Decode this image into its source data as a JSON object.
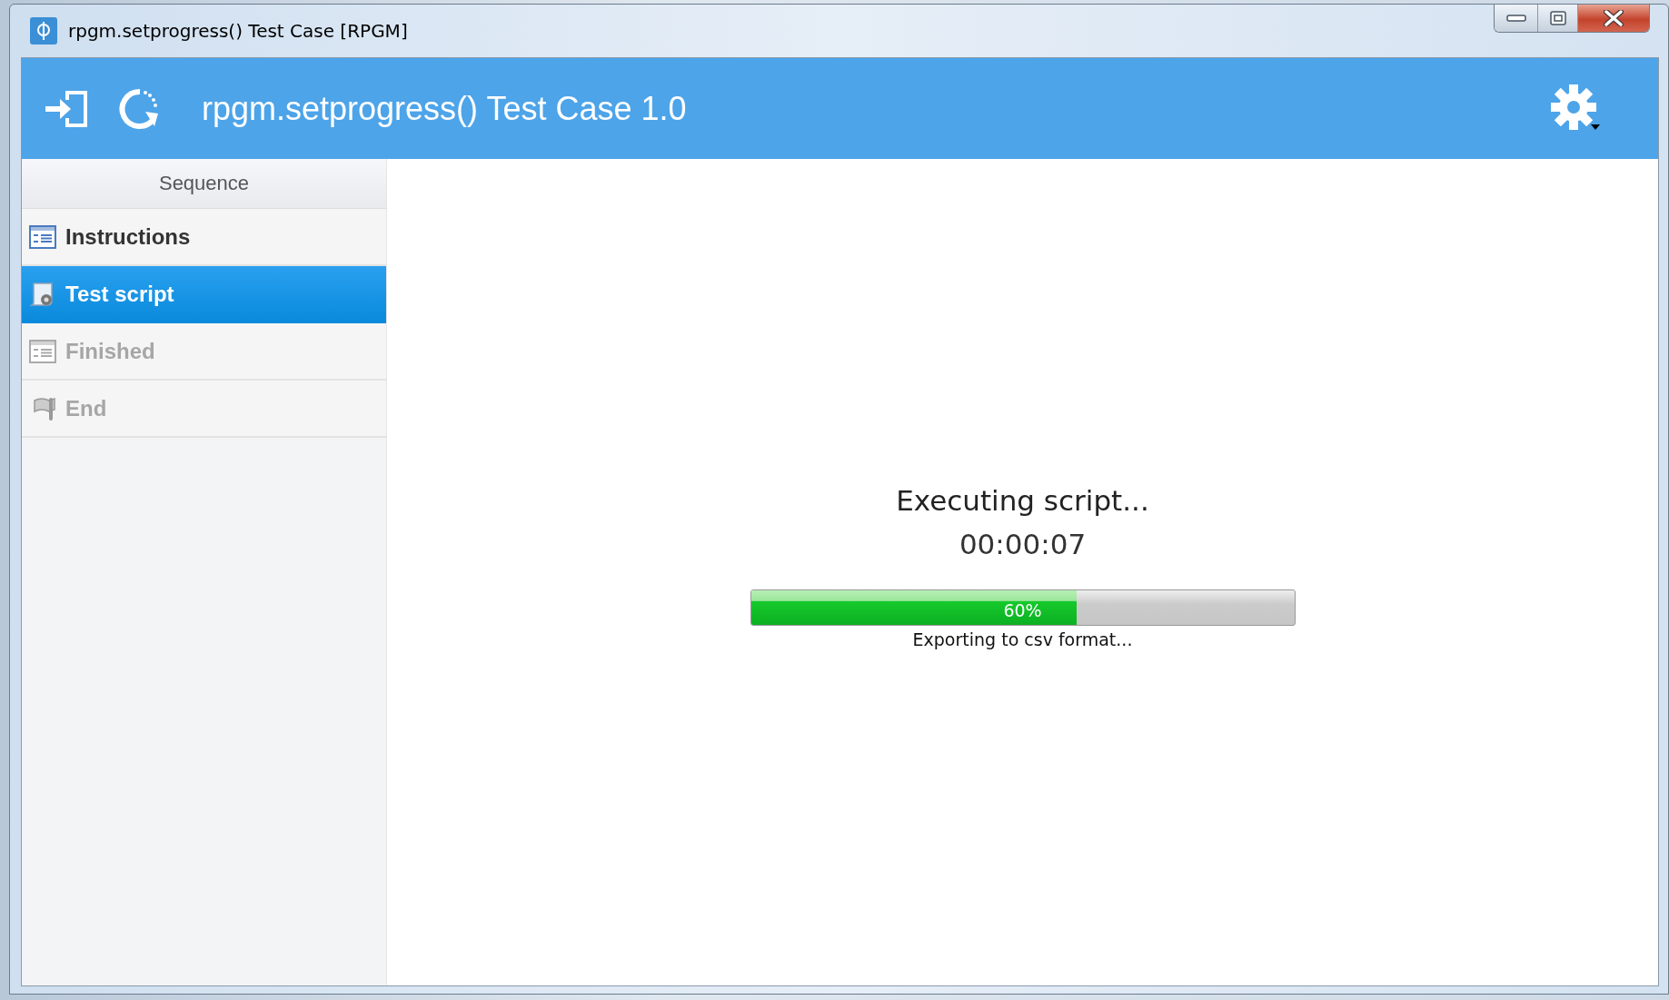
{
  "window": {
    "title": "rpgm.setprogress() Test Case [RPGM]"
  },
  "header": {
    "title": "rpgm.setprogress() Test Case 1.0"
  },
  "sidebar": {
    "heading": "Sequence",
    "items": [
      {
        "label": "Instructions",
        "selected": false,
        "disabled": false
      },
      {
        "label": "Test script",
        "selected": true,
        "disabled": false
      },
      {
        "label": "Finished",
        "selected": false,
        "disabled": true
      },
      {
        "label": "End",
        "selected": false,
        "disabled": true
      }
    ]
  },
  "status": {
    "message": "Executing script...",
    "elapsed": "00:00:07",
    "progress": {
      "level": 0.6,
      "label": "60%",
      "caption": "Exporting to csv format..."
    }
  }
}
